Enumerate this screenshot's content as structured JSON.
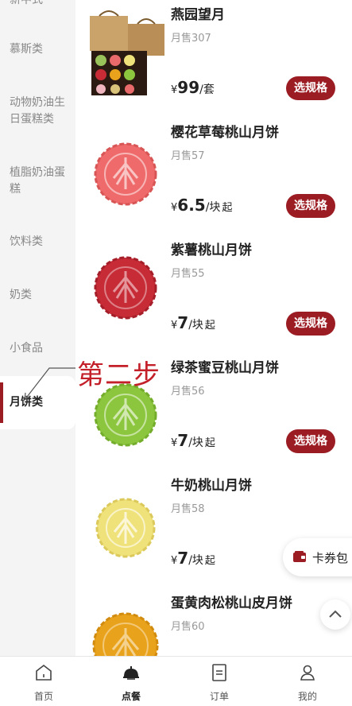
{
  "sidebar": {
    "items": [
      {
        "label": "新中式"
      },
      {
        "label": "慕斯类"
      },
      {
        "label": "动物奶油生日蛋糕类"
      },
      {
        "label": "植脂奶油蛋糕"
      },
      {
        "label": "饮料类"
      },
      {
        "label": "奶类"
      },
      {
        "label": "小食品"
      },
      {
        "label": "月饼类"
      }
    ]
  },
  "products": [
    {
      "name": "燕园望月",
      "sales": "月售307",
      "currency": "¥",
      "price": "99",
      "unit": "/套",
      "suffix": "",
      "button": "选规格"
    },
    {
      "name": "樱花草莓桃山月饼",
      "sales": "月售57",
      "currency": "¥",
      "price": "6.5",
      "unit": "/块",
      "suffix": "起",
      "button": "选规格",
      "color": "#ef6b6b"
    },
    {
      "name": "紫薯桃山月饼",
      "sales": "月售55",
      "currency": "¥",
      "price": "7",
      "unit": "/块",
      "suffix": "起",
      "button": "选规格",
      "color": "#c62b36"
    },
    {
      "name": "绿茶蜜豆桃山月饼",
      "sales": "月售56",
      "currency": "¥",
      "price": "7",
      "unit": "/块",
      "suffix": "起",
      "button": "选规格",
      "color": "#8cc63e"
    },
    {
      "name": "牛奶桃山月饼",
      "sales": "月售58",
      "currency": "¥",
      "price": "7",
      "unit": "/块",
      "suffix": "起",
      "button": "",
      "color": "#efe27a"
    },
    {
      "name": "蛋黄肉松桃山皮月饼",
      "sales": "月售60",
      "currency": "",
      "price": "",
      "unit": "",
      "suffix": "",
      "button": "",
      "color": "#e9a21b"
    }
  ],
  "annotation": {
    "text": "第二步"
  },
  "coupon": {
    "label": "卡券包"
  },
  "tabbar": {
    "items": [
      {
        "label": "首页"
      },
      {
        "label": "点餐"
      },
      {
        "label": "订单"
      },
      {
        "label": "我的"
      }
    ]
  },
  "colors": {
    "accent": "#9b1c23",
    "annotation": "#c3202a"
  }
}
